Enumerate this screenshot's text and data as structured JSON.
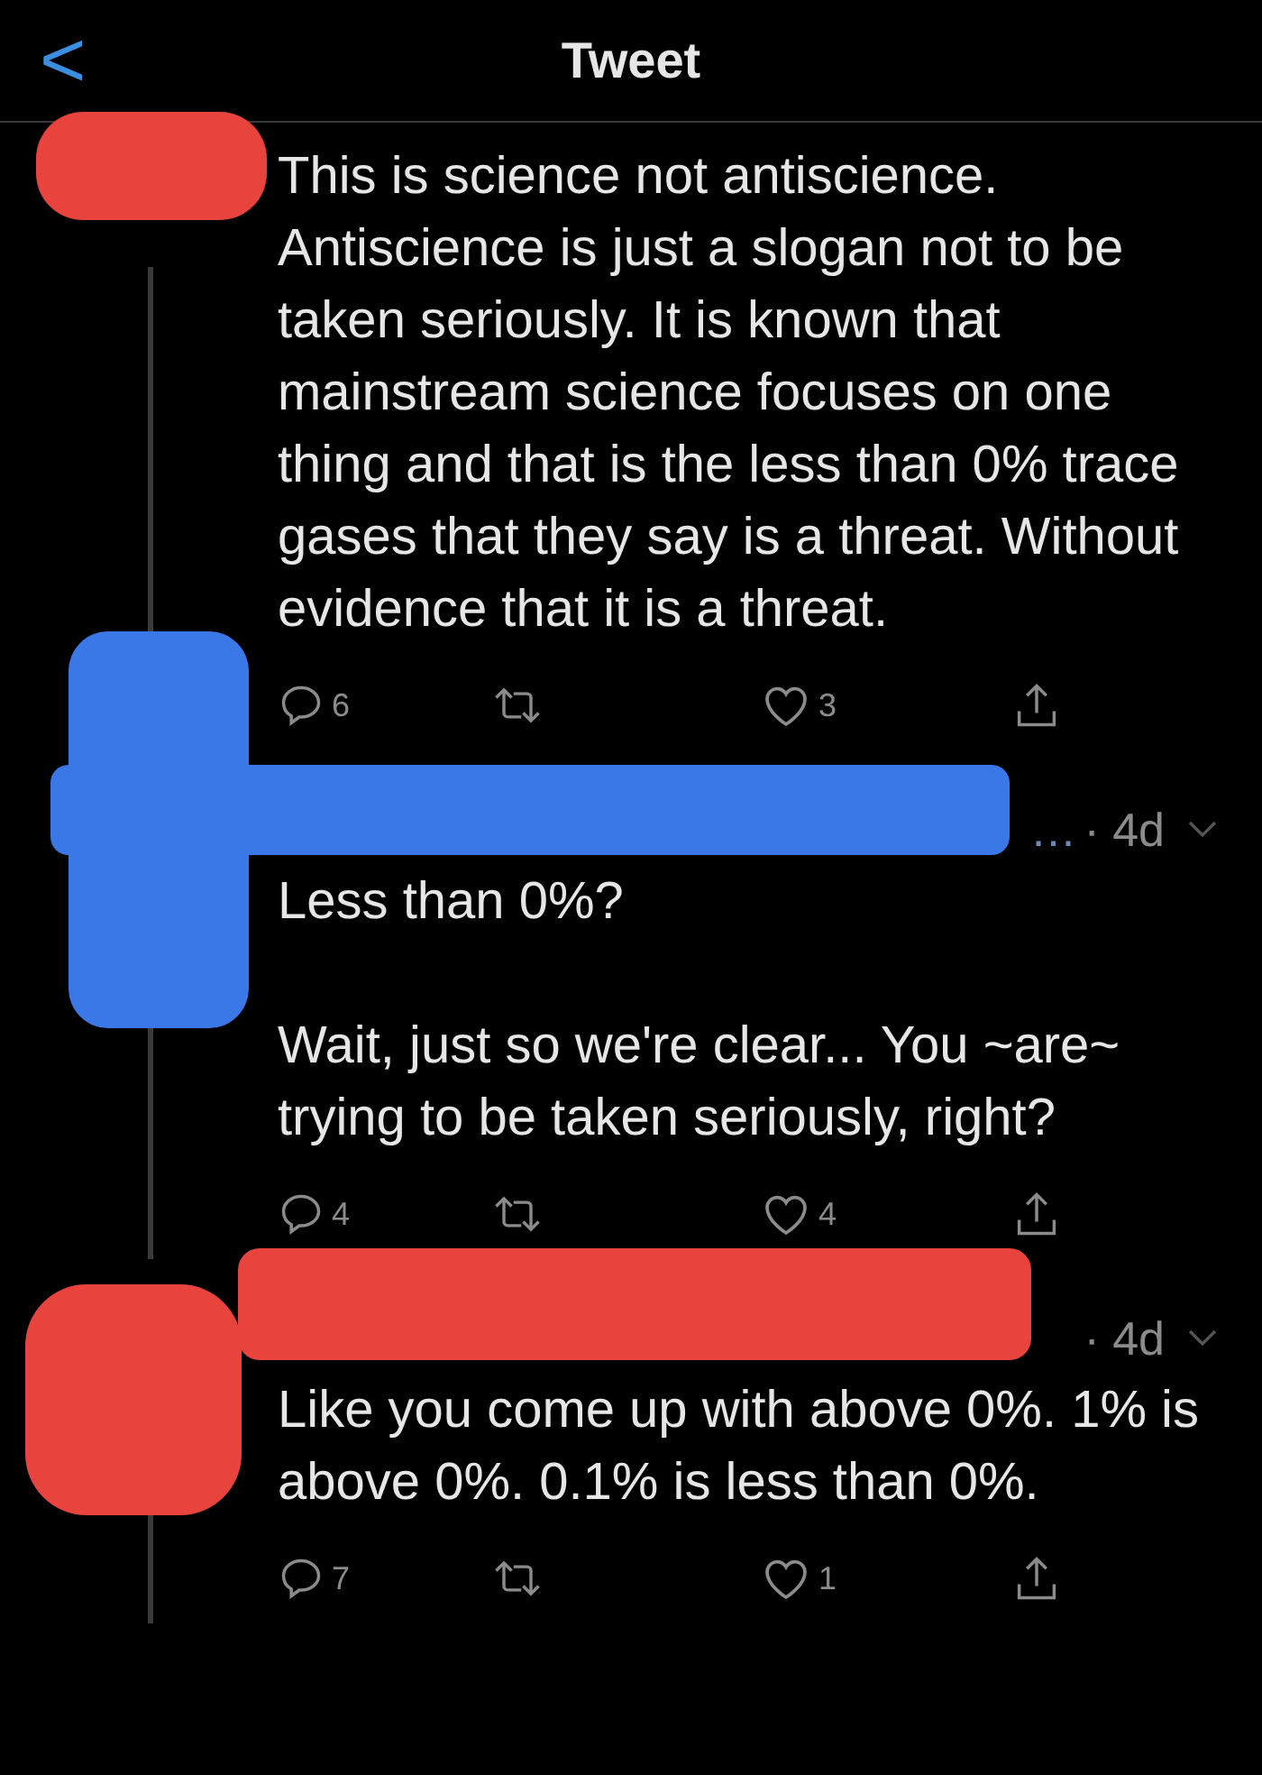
{
  "header": {
    "back": "<",
    "title": "Tweet"
  },
  "tweets": [
    {
      "color": "#e8433d",
      "paragraphs": [
        "This is science not antiscience. Antiscience is just a slogan not to be taken seriously. It is known that mainstream science focuses on one thing and that is the less than 0% trace gases that they say is a threat. Without evidence that it is a threat."
      ],
      "replies": "6",
      "likes": "3"
    },
    {
      "color": "#3b78e7",
      "ellipsis": "…",
      "time": "· 4d",
      "paragraphs": [
        "Less than 0%?",
        "Wait, just so we're clear... You ~are~ trying to be taken seriously, right?"
      ],
      "replies": "4",
      "likes": "4"
    },
    {
      "color": "#e8433d",
      "time": "· 4d",
      "paragraphs": [
        "Like you come up with above 0%. 1% is above 0%. 0.1% is less than 0%."
      ],
      "replies": "7",
      "likes": "1"
    }
  ]
}
